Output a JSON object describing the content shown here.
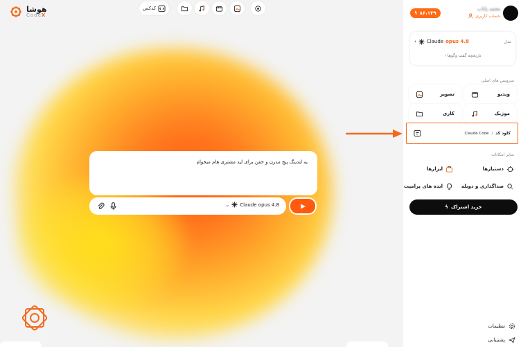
{
  "brand": {
    "name": "هوشا",
    "sub_prefix": "Code",
    "sub_accent": "X"
  },
  "toolbar": {
    "codex_label": "کدکس",
    "codex_icon": "code-icon"
  },
  "chat": {
    "message": "یه لندینگ پیج مدرن و خفن برای لید مشتری هام میخوام"
  },
  "input": {
    "model_name": "Claude opus 4.8"
  },
  "user": {
    "name": "محمد پاناب",
    "account": "حساب کاربری",
    "credit": "۸۶،۱۳۹"
  },
  "model_card": {
    "label": "مدل",
    "model_prefix": "Claude",
    "model_accent": "opus 4.8",
    "history": "تاریخچه گفت وگوها"
  },
  "services": {
    "title": "سرویس های اصلی",
    "items": [
      {
        "label": "ویدیو"
      },
      {
        "label": "تصویر"
      },
      {
        "label": "موزیک"
      },
      {
        "label": "کاری"
      }
    ],
    "code": {
      "label": "کلود کد",
      "sep": "/",
      "sub": "Claude Code"
    }
  },
  "features": {
    "title": "سایر امکانات",
    "items": [
      {
        "label": "دستیارها"
      },
      {
        "label": "ابزارها"
      },
      {
        "label": "صداگذاری و دوبله"
      },
      {
        "label": "ایده های پرامپت"
      }
    ]
  },
  "buy": {
    "label": "خرید اشتراک"
  },
  "footer": {
    "settings": "تنظیمات",
    "support": "پشتیبانی"
  },
  "colors": {
    "accent": "#f26b1d",
    "send": "#ff5a0d",
    "dark": "#0d0d0d"
  }
}
